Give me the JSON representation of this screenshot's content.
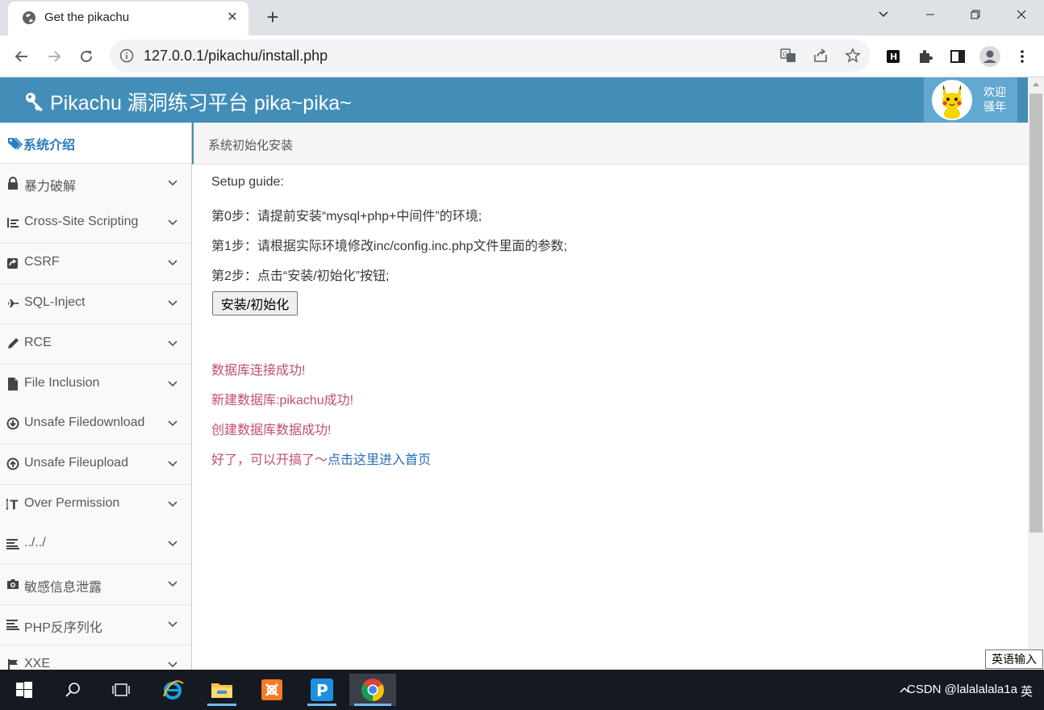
{
  "browser": {
    "tab_title": "Get the pikachu",
    "tab_close": "✕",
    "new_tab": "+",
    "url": "127.0.0.1/pikachu/install.php"
  },
  "header": {
    "brand": "Pikachu 漏洞练习平台 pika~pika~",
    "welcome_line1": "欢迎",
    "welcome_line2": "骚年"
  },
  "sidebar": {
    "active_item": "系统介绍",
    "items": [
      {
        "label": "暴力破解",
        "icon": "lock-icon"
      },
      {
        "label": "Cross-Site Scripting",
        "icon": "code-icon"
      },
      {
        "label": "CSRF",
        "icon": "share-icon"
      },
      {
        "label": "SQL-Inject",
        "icon": "plane-icon"
      },
      {
        "label": "RCE",
        "icon": "pencil-icon"
      },
      {
        "label": "File Inclusion",
        "icon": "file-icon"
      },
      {
        "label": "Unsafe Filedownload",
        "icon": "download-circle-icon"
      },
      {
        "label": "Unsafe Fileupload",
        "icon": "upload-circle-icon"
      },
      {
        "label": "Over Permission",
        "icon": "text-height-icon"
      },
      {
        "label": "../../",
        "icon": "align-left-icon"
      },
      {
        "label": "敏感信息泄露",
        "icon": "camera-icon"
      },
      {
        "label": "PHP反序列化",
        "icon": "align-left-icon"
      },
      {
        "label": "XXE",
        "icon": "flag-icon"
      }
    ]
  },
  "breadcrumb": "系统初始化安装",
  "guide": {
    "heading": "Setup guide:",
    "step0": "第0步：请提前安装“mysql+php+中间件”的环境;",
    "step1": "第1步：请根据实际环境修改inc/config.inc.php文件里面的参数;",
    "step2": "第2步：点击“安装/初始化”按钮;",
    "button": "安装/初始化"
  },
  "messages": {
    "db_connect": "数据库连接成功!",
    "db_create": "新建数据库:pikachu成功!",
    "data_create": "创建数据库数据成功!",
    "done_prefix": "好了，可以开搞了～",
    "done_link": "点击这里进入首页"
  },
  "ime_tooltip": "英语输入",
  "taskbar": {
    "watermark": "CSDN @lalalalala1a",
    "ime_indicator": "英"
  },
  "colors": {
    "header_bg": "#438eb9",
    "user_box_bg": "#62a8d1",
    "active_nav": "#2b7dbc",
    "message": "#c04d74",
    "link": "#2b6eb5"
  }
}
